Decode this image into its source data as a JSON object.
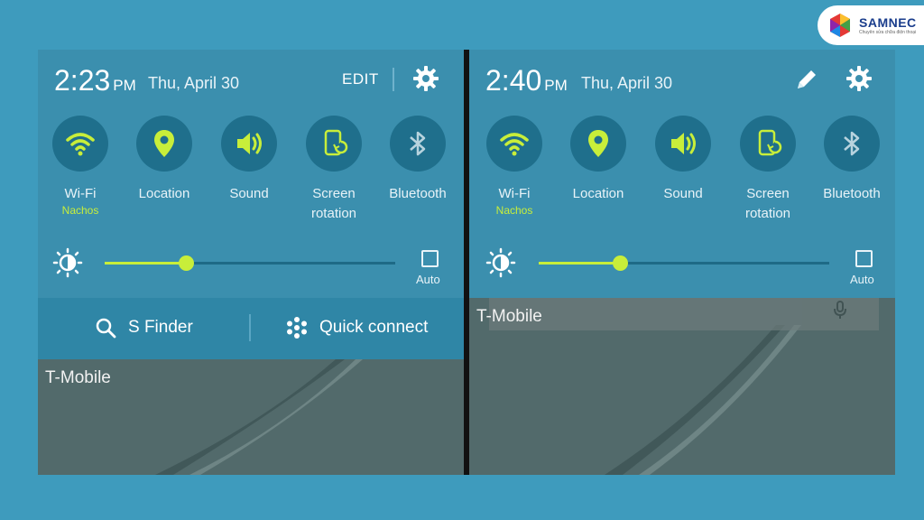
{
  "logo": {
    "name": "SAMNEC",
    "tagline": "Chuyên sửa chữa điện thoại"
  },
  "panels": [
    {
      "time": "2:23",
      "ampm": "PM",
      "date": "Thu, April 30",
      "edit_label": "EDIT",
      "toggles": [
        {
          "icon": "wifi-icon",
          "label": "Wi-Fi",
          "sub": "Nachos"
        },
        {
          "icon": "location-icon",
          "label": "Location"
        },
        {
          "icon": "sound-icon",
          "label": "Sound"
        },
        {
          "icon": "screen-rotation-icon",
          "label": "Screen rotation"
        },
        {
          "icon": "bluetooth-icon",
          "label": "Bluetooth"
        }
      ],
      "brightness": 0.28,
      "auto_label": "Auto",
      "actions": {
        "s_finder": "S Finder",
        "quick_connect": "Quick connect"
      },
      "carrier": "T-Mobile"
    },
    {
      "time": "2:40",
      "ampm": "PM",
      "date": "Thu, April 30",
      "toggles": [
        {
          "icon": "wifi-icon",
          "label": "Wi-Fi",
          "sub": "Nachos"
        },
        {
          "icon": "location-icon",
          "label": "Location"
        },
        {
          "icon": "sound-icon",
          "label": "Sound"
        },
        {
          "icon": "screen-rotation-icon",
          "label": "Screen rotation"
        },
        {
          "icon": "bluetooth-icon",
          "label": "Bluetooth"
        }
      ],
      "brightness": 0.28,
      "auto_label": "Auto",
      "carrier": "T-Mobile"
    }
  ],
  "colors": {
    "accent": "#c8ee3a",
    "panel": "#3b8fae",
    "circle": "#1f6f8c",
    "background": "#3e9bbd"
  }
}
